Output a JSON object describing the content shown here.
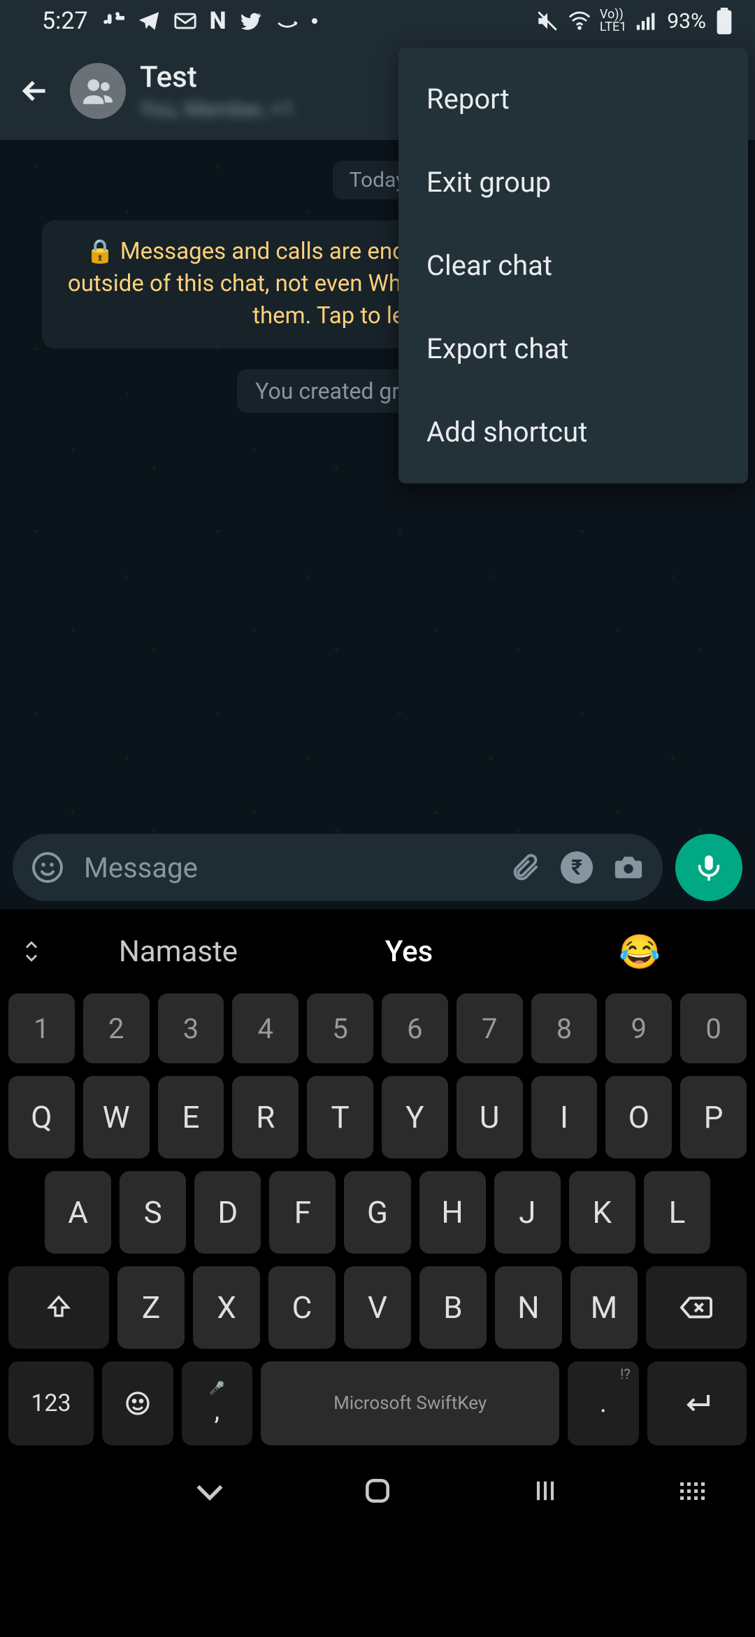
{
  "status": {
    "time": "5:27",
    "icons_left": [
      "slack",
      "telegram",
      "gmail",
      "netflix",
      "twitter",
      "amazon",
      "dot"
    ],
    "icons_right": [
      "mute",
      "wifi",
      "volte",
      "signal"
    ],
    "battery_pct": "93%"
  },
  "header": {
    "title": "Test",
    "subtitle": "You, Member, +1"
  },
  "chat": {
    "date_chip": "Today",
    "encryption_banner": "Messages and calls are end-to-end encrypted. No one outside of this chat, not even WhatsApp, can read or listen to them. Tap to learn more.",
    "system_chip": "You created group \"Test\""
  },
  "input": {
    "placeholder": "Message"
  },
  "menu": {
    "items": [
      "Report",
      "Exit group",
      "Clear chat",
      "Export chat",
      "Add shortcut"
    ]
  },
  "keyboard": {
    "suggestions": [
      "Namaste",
      "Yes",
      "😂"
    ],
    "row_num": [
      "1",
      "2",
      "3",
      "4",
      "5",
      "6",
      "7",
      "8",
      "9",
      "0"
    ],
    "row1": [
      "Q",
      "W",
      "E",
      "R",
      "T",
      "Y",
      "U",
      "I",
      "O",
      "P"
    ],
    "row2": [
      "A",
      "S",
      "D",
      "F",
      "G",
      "H",
      "J",
      "K",
      "L"
    ],
    "row3": [
      "Z",
      "X",
      "C",
      "V",
      "B",
      "N",
      "M"
    ],
    "numeric_label": "123",
    "comma_hint": "🎤",
    "comma": ",",
    "space_label": "Microsoft SwiftKey",
    "period": ".",
    "period_hint": "!?"
  }
}
